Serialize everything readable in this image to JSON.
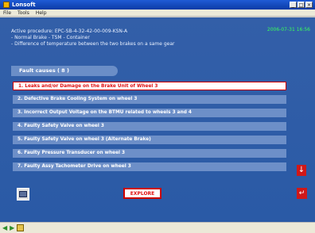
{
  "window": {
    "title": "Lonsoft",
    "controls": [
      "_",
      "□",
      "×"
    ]
  },
  "menu": {
    "items": [
      "File",
      "Tools",
      "Help"
    ]
  },
  "main": {
    "procedure": "Active procedure: EPC-SB-4-32-42-00-009-KSN-A",
    "bullets": [
      "- Normal Brake - TSM - Container",
      "- Difference of temperature between the two brakes on a same gear"
    ],
    "datetime": "2006-07-31 16:56"
  },
  "faults": {
    "header": "Fault causes ( 8 )",
    "items": [
      "1. Leaks and/or Damage on the Brake Unit of Wheel 3",
      "2. Defective Brake Cooling System on wheel 3",
      "3. Incorrect Output Voltage on the BTMU related to wheels 3 and 4",
      "4. Faulty Safety Valve on wheel 3",
      "5. Faulty Safety Valve on wheel 3 (Alternate Brake)",
      "6. Faulty Pressure Transducer on wheel 3",
      "7. Faulty Assy Tachometer Drive on wheel 3"
    ]
  },
  "actions": {
    "explore_label": "EXPLORE"
  },
  "icons": {
    "scroll_down": "arrow-down-icon",
    "return": "return-arrow-icon",
    "home": "home-icon",
    "nav_back": "nav-back-icon",
    "nav_forward": "nav-forward-icon",
    "status": "status-icon"
  }
}
